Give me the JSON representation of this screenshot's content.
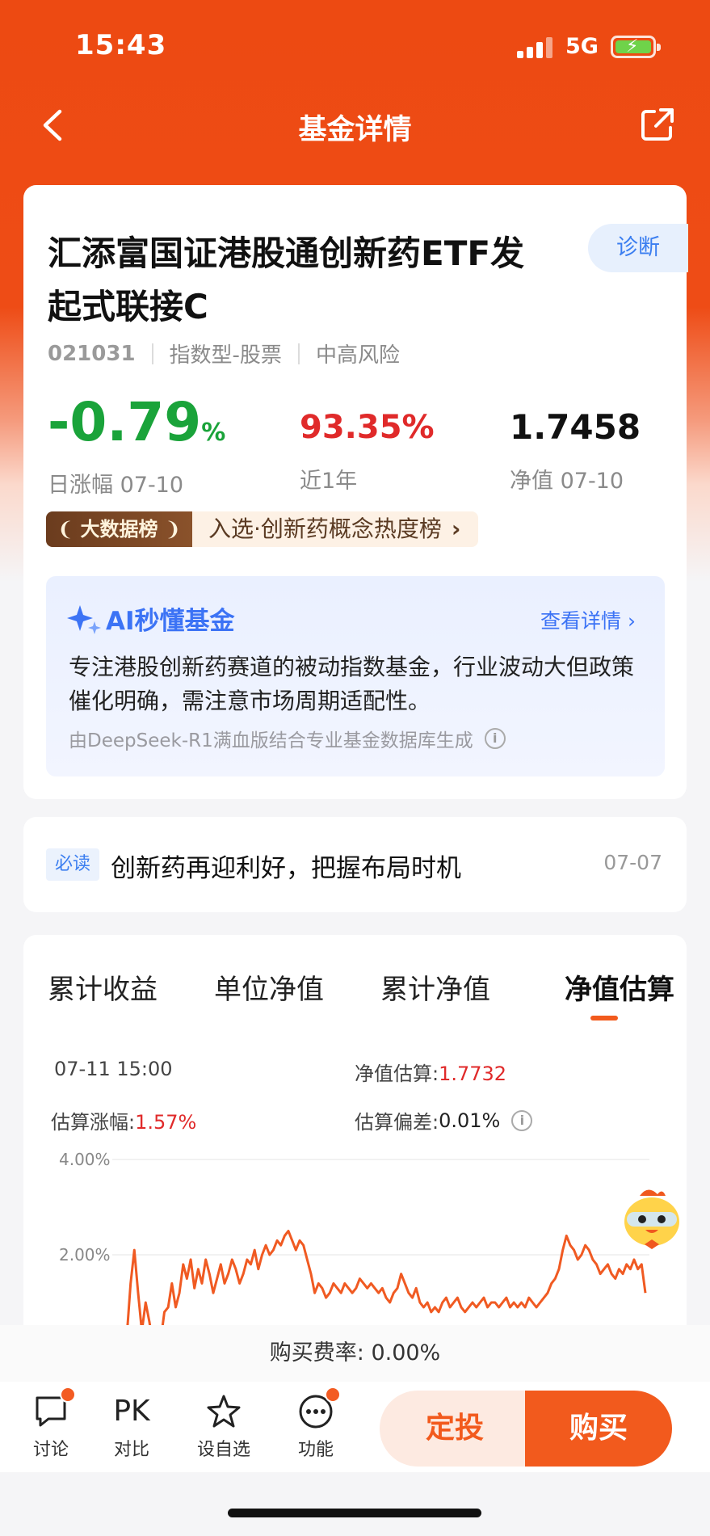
{
  "status": {
    "time": "15:43",
    "network": "5G"
  },
  "nav": {
    "title": "基金详情"
  },
  "fund": {
    "name": "汇添富国证港股通创新药ETF发起式联接C",
    "diagnose": "诊断",
    "code": "021031",
    "type": "指数型-股票",
    "risk": "中高风险",
    "daily_change": "-0.79",
    "daily_change_unit": "%",
    "daily_change_label": "日涨幅 07-10",
    "year_return": "93.35%",
    "year_return_label": "近1年",
    "nav": "1.7458",
    "nav_label": "净值 07-10",
    "rank_badge": "大数据榜",
    "rank_text": "入选·创新药概念热度榜"
  },
  "ai": {
    "title": "AI秒懂基金",
    "more": "查看详情 ",
    "body": "专注港股创新药赛道的被动指数基金，行业波动大但政策催化明确，需注意市场周期适配性。",
    "footnote": "由DeepSeek-R1满血版结合专业基金数据库生成"
  },
  "news": {
    "tag": "必读",
    "title": "创新药再迎利好，把握布局时机",
    "date": "07-07"
  },
  "tabs": [
    "累计收益",
    "单位净值",
    "累计净值",
    "净值估算"
  ],
  "active_tab": 3,
  "estimate": {
    "time": "07-11 15:00",
    "nav_est_label": "净值估算:",
    "nav_est_value": "1.7732",
    "change_label": "估算涨幅:",
    "change_value": "1.57%",
    "deviation_label": "估算偏差:",
    "deviation_value": "0.01%"
  },
  "chart_data": {
    "type": "line",
    "y_ticks": [
      "4.00%",
      "2.00%"
    ],
    "series": [
      {
        "values": [
          0.3,
          1.4,
          2.1,
          1.2,
          0.4,
          1.0,
          0.6,
          0.1,
          0.5,
          0.2,
          0.8,
          0.9,
          1.4,
          0.9,
          1.2,
          1.8,
          1.5,
          1.9,
          1.3,
          1.7,
          1.4,
          1.9,
          1.6,
          1.2,
          1.5,
          1.8,
          1.4,
          1.6,
          1.9,
          1.7,
          1.4,
          1.6,
          1.9,
          1.8,
          2.1,
          1.7,
          2.0,
          2.2,
          2.0,
          2.1,
          2.3,
          2.2,
          2.4,
          2.5,
          2.3,
          2.1,
          2.3,
          2.2,
          1.9,
          1.6,
          1.2,
          1.4,
          1.3,
          1.1,
          1.2,
          1.4,
          1.3,
          1.2,
          1.4,
          1.3,
          1.2,
          1.3,
          1.5,
          1.4,
          1.3,
          1.4,
          1.3,
          1.2,
          1.3,
          1.1,
          1.0,
          1.2,
          1.3,
          1.6,
          1.4,
          1.2,
          1.1,
          1.3,
          1.0,
          0.9,
          1.0,
          0.8,
          0.9,
          0.8,
          1.0,
          1.1,
          0.9,
          1.0,
          1.1,
          0.9,
          0.8,
          0.9,
          1.0,
          0.9,
          1.0,
          1.1,
          0.9,
          1.0,
          1.0,
          0.9,
          1.0,
          1.1,
          0.9,
          1.0,
          0.9,
          1.0,
          0.9,
          1.1,
          1.0,
          0.9,
          1.0,
          1.1,
          1.2,
          1.4,
          1.5,
          1.7,
          2.1,
          2.4,
          2.2,
          2.1,
          1.9,
          2.0,
          2.2,
          2.1,
          1.9,
          1.8,
          1.6,
          1.7,
          1.8,
          1.6,
          1.5,
          1.7,
          1.6,
          1.8,
          1.7,
          1.9,
          1.7,
          1.8,
          1.2
        ]
      }
    ],
    "ylim": [
      0,
      4.5
    ]
  },
  "fee": "购买费率: 0.00%",
  "bottom": {
    "items": [
      "讨论",
      "对比",
      "设自选",
      "功能"
    ],
    "pk": "PK",
    "sip": "定投",
    "buy": "购买"
  },
  "colors": {
    "brand": "#ed4a12",
    "rise": "#e02a2a",
    "fall": "#1aa33a",
    "accent": "#3b7ef0"
  }
}
